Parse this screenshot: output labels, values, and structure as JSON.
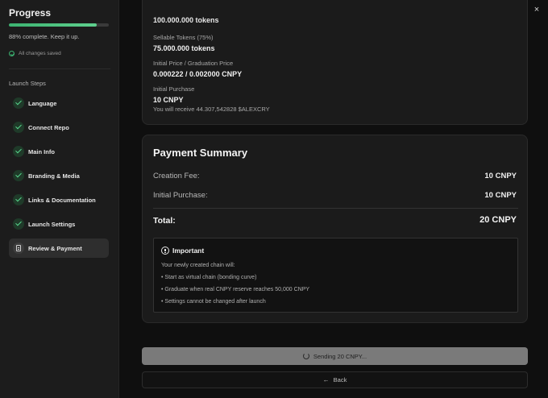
{
  "sidebar": {
    "title": "Progress",
    "progress_percent": 88,
    "progress_text": "88% complete. Keep it up.",
    "saved_text": "All changes saved",
    "steps_heading": "Launch Steps",
    "steps": [
      {
        "label": "Language",
        "status": "complete",
        "icon": "check-icon"
      },
      {
        "label": "Connect Repo",
        "status": "complete",
        "icon": "check-icon"
      },
      {
        "label": "Main Info",
        "status": "complete",
        "icon": "check-icon"
      },
      {
        "label": "Branding & Media",
        "status": "complete",
        "icon": "check-icon"
      },
      {
        "label": "Links & Documentation",
        "status": "complete",
        "icon": "check-icon"
      },
      {
        "label": "Launch Settings",
        "status": "complete",
        "icon": "check-icon"
      },
      {
        "label": "Review & Payment",
        "status": "active",
        "icon": "document-icon"
      }
    ]
  },
  "close_label": "×",
  "token_card": {
    "cut_value": "100.000.000 tokens",
    "sellable_label": "Sellable Tokens (75%)",
    "sellable_value": "75.000.000 tokens",
    "price_label": "Initial Price / Graduation Price",
    "price_value": "0.000222 / 0.002000 CNPY",
    "purchase_label": "Initial Purchase",
    "purchase_value": "10 CNPY",
    "receive_text": "You will receive 44.307,542828 $ALEXCRY"
  },
  "payment": {
    "title": "Payment Summary",
    "creation_fee_label": "Creation Fee:",
    "creation_fee_value": "10 CNPY",
    "initial_purchase_label": "Initial Purchase:",
    "initial_purchase_value": "10 CNPY",
    "total_label": "Total:",
    "total_value": "20 CNPY",
    "important": {
      "title": "Important",
      "intro": "Your newly created chain will:",
      "items": [
        "• Start as virtual chain (bonding curve)",
        "• Graduate when real CNPY reserve reaches 50,000 CNPY",
        "• Settings cannot be changed after launch"
      ]
    }
  },
  "actions": {
    "sending_label": "Sending 20 CNPY...",
    "back_label": "Back"
  },
  "colors": {
    "accent": "#3cb371",
    "background": "#0f0f0f",
    "sidebar": "#1c1c1c",
    "card": "#1b1b1b"
  }
}
